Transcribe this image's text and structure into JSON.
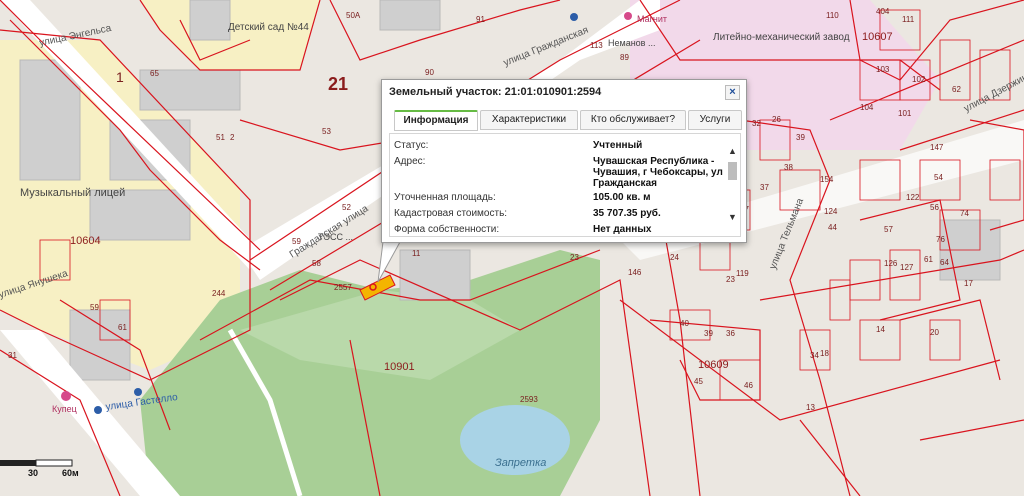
{
  "map": {
    "parcels": [
      "10604",
      "10901",
      "10609",
      "10607"
    ],
    "streets": [
      "Гражданская улица",
      "улица Гражданская",
      "улица Энгельса",
      "улица Янушека",
      "улица Тельмана",
      "улица Дзержинского",
      "улица Гастелло"
    ],
    "places": [
      "Детский сад №44",
      "Музыкальный лицей",
      "Литейно-механический завод",
      "ТЭСС ...",
      "Магнит",
      "Купец",
      "Запретка",
      "Неманов ..."
    ],
    "quarter": "21",
    "house_numbers": [
      "50А",
      "91",
      "90",
      "65",
      "59",
      "61",
      "53",
      "51",
      "2",
      "1",
      "113",
      "89",
      "52",
      "59",
      "58",
      "244",
      "2557",
      "23",
      "146",
      "11",
      "32",
      "26",
      "39",
      "38",
      "37",
      "47",
      "154",
      "124",
      "44",
      "40",
      "39",
      "36",
      "46",
      "45",
      "24",
      "23",
      "119",
      "122",
      "126",
      "127",
      "54",
      "56",
      "57",
      "74",
      "76",
      "61",
      "64",
      "17",
      "14",
      "20",
      "18",
      "2593",
      "31",
      "110",
      "111",
      "404",
      "103",
      "102",
      "62",
      "147",
      "101",
      "104",
      "34",
      "13"
    ],
    "scale": {
      "labels": [
        "30",
        "60м"
      ]
    },
    "colors": {
      "parcel_border": "#d9141e",
      "park": "#a8cf96",
      "water": "#a9d3e6",
      "road": "#ffffff",
      "yellow_zone": "#f7f0c4",
      "pink_zone": "#f2d9ea"
    }
  },
  "popup": {
    "title": "Земельный участок: 21:01:010901:2594",
    "close_label": "×",
    "tabs": [
      {
        "label": "Информация",
        "active": true
      },
      {
        "label": "Характеристики",
        "active": false
      },
      {
        "label": "Кто обслуживает?",
        "active": false
      },
      {
        "label": "Услуги",
        "active": false
      }
    ],
    "rows": [
      {
        "key": "Статус:",
        "value": "Учтенный"
      },
      {
        "key": "Адрес:",
        "value": "Чувашская Республика - Чувашия, г Чебоксары, ул Гражданская"
      },
      {
        "key": "Уточненная площадь:",
        "value": "105.00 кв. м"
      },
      {
        "key": "Кадастровая стоимость:",
        "value": "35 707.35 руб."
      },
      {
        "key": "Форма собственности:",
        "value": "Нет данных"
      }
    ],
    "scroll_up": "▲",
    "scroll_down": "▼"
  }
}
